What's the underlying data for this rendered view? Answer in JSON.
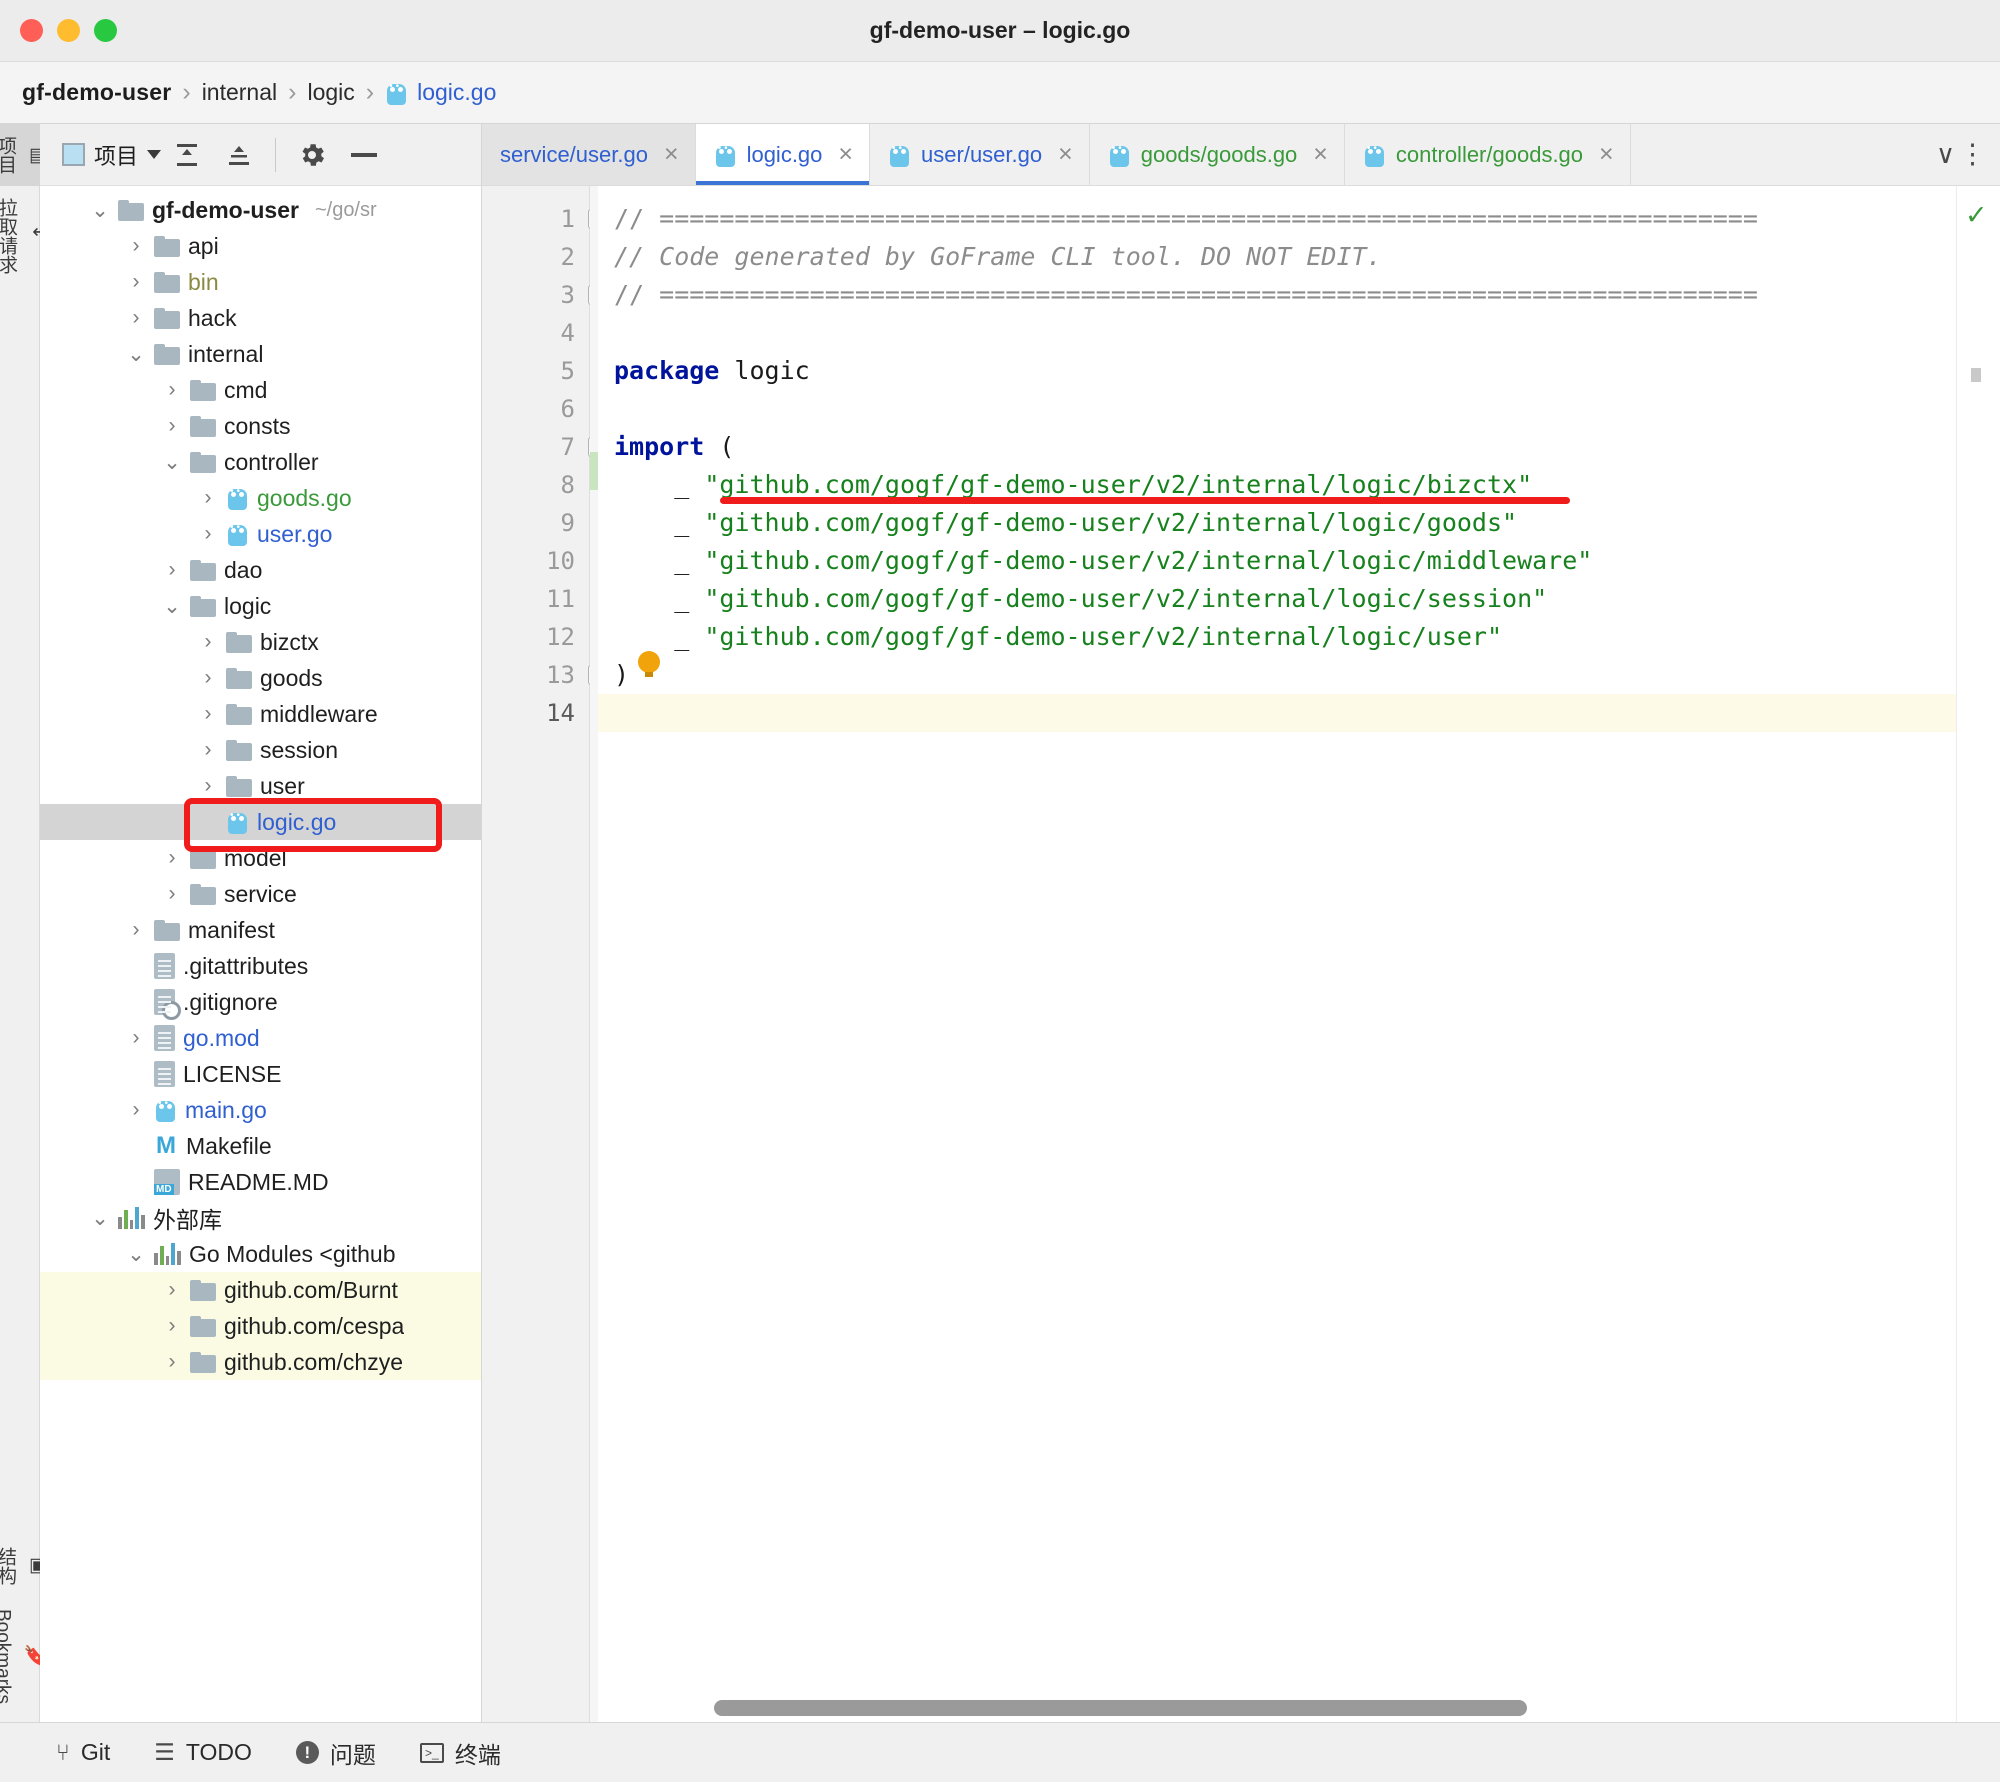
{
  "window": {
    "title": "gf-demo-user – logic.go",
    "traffic_lights": [
      "close",
      "minimize",
      "zoom"
    ]
  },
  "breadcrumb": {
    "items": [
      "gf-demo-user",
      "internal",
      "logic",
      "logic.go"
    ],
    "separator": "›",
    "file_icon": "go-gopher-icon"
  },
  "left_rail": {
    "top": [
      {
        "label": "项目",
        "icon": "project-panel-icon",
        "active": true
      },
      {
        "label": "拉取请求",
        "icon": "pull-request-icon",
        "active": false
      }
    ],
    "bottom": [
      {
        "label": "结构",
        "icon": "structure-icon",
        "active": false
      },
      {
        "label": "Bookmarks",
        "icon": "bookmark-icon",
        "active": false
      }
    ]
  },
  "project_panel": {
    "toolbar": {
      "title": "项目",
      "dropdown_caret": "▾",
      "icons": [
        "expand-all-icon",
        "collapse-all-icon",
        "settings-gear-icon",
        "hide-panel-icon"
      ]
    },
    "tree": [
      {
        "label": "gf-demo-user",
        "hint": "~/go/sr",
        "depth": 0,
        "kind": "folder",
        "arrow": "v",
        "style": "bold"
      },
      {
        "label": "api",
        "depth": 1,
        "kind": "folder",
        "arrow": ">",
        "style": "plain"
      },
      {
        "label": "bin",
        "depth": 1,
        "kind": "folder",
        "arrow": ">",
        "style": "olive"
      },
      {
        "label": "hack",
        "depth": 1,
        "kind": "folder",
        "arrow": ">",
        "style": "plain"
      },
      {
        "label": "internal",
        "depth": 1,
        "kind": "folder",
        "arrow": "v",
        "style": "plain"
      },
      {
        "label": "cmd",
        "depth": 2,
        "kind": "folder",
        "arrow": ">",
        "style": "plain"
      },
      {
        "label": "consts",
        "depth": 2,
        "kind": "folder",
        "arrow": ">",
        "style": "plain"
      },
      {
        "label": "controller",
        "depth": 2,
        "kind": "folder",
        "arrow": "v",
        "style": "plain"
      },
      {
        "label": "goods.go",
        "depth": 3,
        "kind": "gopher",
        "arrow": ">",
        "style": "green"
      },
      {
        "label": "user.go",
        "depth": 3,
        "kind": "gopher",
        "arrow": ">",
        "style": "blue"
      },
      {
        "label": "dao",
        "depth": 2,
        "kind": "folder",
        "arrow": ">",
        "style": "plain"
      },
      {
        "label": "logic",
        "depth": 2,
        "kind": "folder",
        "arrow": "v",
        "style": "plain"
      },
      {
        "label": "bizctx",
        "depth": 3,
        "kind": "folder",
        "arrow": ">",
        "style": "plain"
      },
      {
        "label": "goods",
        "depth": 3,
        "kind": "folder",
        "arrow": ">",
        "style": "plain"
      },
      {
        "label": "middleware",
        "depth": 3,
        "kind": "folder",
        "arrow": ">",
        "style": "plain"
      },
      {
        "label": "session",
        "depth": 3,
        "kind": "folder",
        "arrow": ">",
        "style": "plain"
      },
      {
        "label": "user",
        "depth": 3,
        "kind": "folder",
        "arrow": ">",
        "style": "plain"
      },
      {
        "label": "logic.go",
        "depth": 3,
        "kind": "gopher",
        "arrow": "",
        "style": "blue",
        "selected": true
      },
      {
        "label": "model",
        "depth": 2,
        "kind": "folder",
        "arrow": ">",
        "style": "plain"
      },
      {
        "label": "service",
        "depth": 2,
        "kind": "folder",
        "arrow": ">",
        "style": "plain"
      },
      {
        "label": "manifest",
        "depth": 1,
        "kind": "folder",
        "arrow": ">",
        "style": "plain"
      },
      {
        "label": ".gitattributes",
        "depth": 1,
        "kind": "doc",
        "arrow": "",
        "style": "plain"
      },
      {
        "label": ".gitignore",
        "depth": 1,
        "kind": "doc-ignore",
        "arrow": "",
        "style": "plain"
      },
      {
        "label": "go.mod",
        "depth": 1,
        "kind": "doc",
        "arrow": ">",
        "style": "blue"
      },
      {
        "label": "LICENSE",
        "depth": 1,
        "kind": "doc",
        "arrow": "",
        "style": "plain"
      },
      {
        "label": "main.go",
        "depth": 1,
        "kind": "gopher",
        "arrow": ">",
        "style": "blue"
      },
      {
        "label": "Makefile",
        "depth": 1,
        "kind": "makefile",
        "arrow": "",
        "style": "plain"
      },
      {
        "label": "README.MD",
        "depth": 1,
        "kind": "markdown",
        "arrow": "",
        "style": "plain"
      },
      {
        "label": "外部库",
        "depth": 0,
        "kind": "bars",
        "arrow": "v",
        "style": "plain"
      },
      {
        "label": "Go Modules <github",
        "depth": 1,
        "kind": "bars",
        "arrow": "v",
        "style": "plain"
      },
      {
        "label": "github.com/Burnt",
        "depth": 2,
        "kind": "folder",
        "arrow": ">",
        "style": "plain",
        "extlib": true
      },
      {
        "label": "github.com/cespа",
        "depth": 2,
        "kind": "folder",
        "arrow": ">",
        "style": "plain",
        "extlib": true
      },
      {
        "label": "github.com/chzye",
        "depth": 2,
        "kind": "folder",
        "arrow": ">",
        "style": "plain",
        "extlib": true
      }
    ],
    "annotation": {
      "type": "red-rectangle",
      "target_label": "logic.go",
      "color": "#f01b1b"
    }
  },
  "editor": {
    "tabs": [
      {
        "label": "service/user.go",
        "icon": "none",
        "color": "blue",
        "state": "inactive-highlight",
        "close": "×"
      },
      {
        "label": "logic.go",
        "icon": "go-gopher-icon",
        "color": "blue",
        "state": "active",
        "close": "×"
      },
      {
        "label": "user/user.go",
        "icon": "go-gopher-icon",
        "color": "blue",
        "state": "inactive",
        "close": "×"
      },
      {
        "label": "goods/goods.go",
        "icon": "go-gopher-icon",
        "color": "green",
        "state": "inactive",
        "close": "×"
      },
      {
        "label": "controller/goods.go",
        "icon": "go-gopher-icon",
        "color": "green",
        "state": "inactive",
        "close": "×"
      }
    ],
    "tab_actions": {
      "chevron": "∨",
      "kebab": "⋮"
    },
    "line_numbers": [
      1,
      2,
      3,
      4,
      5,
      6,
      7,
      8,
      9,
      10,
      11,
      12,
      13,
      14
    ],
    "current_line": 14,
    "inspection_status": "ok-check-icon",
    "code_lines": [
      {
        "n": 1,
        "fold": "-",
        "tokens": [
          {
            "t": "comment",
            "v": "// ========================================================================="
          }
        ]
      },
      {
        "n": 2,
        "tokens": [
          {
            "t": "comment-italic",
            "v": "// Code generated by GoFrame CLI tool. DO NOT EDIT."
          }
        ]
      },
      {
        "n": 3,
        "fold": "-",
        "tokens": [
          {
            "t": "comment",
            "v": "// ========================================================================="
          }
        ]
      },
      {
        "n": 4,
        "tokens": []
      },
      {
        "n": 5,
        "tokens": [
          {
            "t": "kw",
            "v": "package"
          },
          {
            "t": "plain",
            "v": " logic"
          }
        ]
      },
      {
        "n": 6,
        "tokens": []
      },
      {
        "n": 7,
        "fold": "-",
        "tokens": [
          {
            "t": "kw",
            "v": "import"
          },
          {
            "t": "plain",
            "v": " ("
          }
        ]
      },
      {
        "n": 8,
        "tokens": [
          {
            "t": "plain",
            "v": "    _ "
          },
          {
            "t": "str",
            "v": "\"github.com/gogf/gf-demo-user/v2/internal/logic/bizctx\""
          }
        ]
      },
      {
        "n": 9,
        "vcs": "modified",
        "tokens": [
          {
            "t": "plain",
            "v": "    _ "
          },
          {
            "t": "str",
            "v": "\"github.com/gogf/gf-demo-user/v2/internal/logic/goods\""
          }
        ]
      },
      {
        "n": 10,
        "tokens": [
          {
            "t": "plain",
            "v": "    _ "
          },
          {
            "t": "str",
            "v": "\"github.com/gogf/gf-demo-user/v2/internal/logic/middleware\""
          }
        ]
      },
      {
        "n": 11,
        "tokens": [
          {
            "t": "plain",
            "v": "    _ "
          },
          {
            "t": "str",
            "v": "\"github.com/gogf/gf-demo-user/v2/internal/logic/session\""
          }
        ]
      },
      {
        "n": 12,
        "tokens": [
          {
            "t": "plain",
            "v": "    _ "
          },
          {
            "t": "str",
            "v": "\"github.com/gogf/gf-demo-user/v2/internal/logic/user\""
          }
        ]
      },
      {
        "n": 13,
        "fold": "-",
        "tokens": [
          {
            "t": "plain",
            "v": ")"
          }
        ],
        "bulb": true
      },
      {
        "n": 14,
        "caret": true,
        "tokens": []
      }
    ],
    "annotation": {
      "type": "red-underline",
      "target_line": 9,
      "color": "#f01b1b"
    },
    "horizontal_scrollbar": true
  },
  "statusbar": {
    "items": [
      {
        "label": "Git",
        "icon": "git-branch-icon"
      },
      {
        "label": "TODO",
        "icon": "list-icon"
      },
      {
        "label": "问题",
        "icon": "problems-icon"
      },
      {
        "label": "终端",
        "icon": "terminal-icon"
      }
    ]
  },
  "colors": {
    "accent_blue": "#2f5fd0",
    "vcs_green": "#3a9a3a",
    "annotation_red": "#f01b1b",
    "string_green": "#17811d",
    "keyword_blue": "#00139b"
  }
}
